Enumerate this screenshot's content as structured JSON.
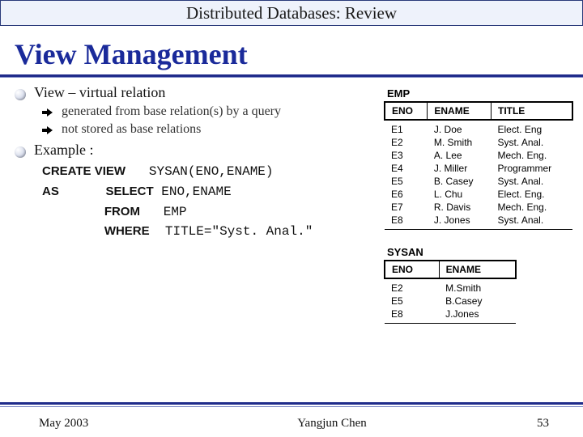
{
  "title_bar": "Distributed Databases: Review",
  "heading": "View Management",
  "bullet_main": "View – virtual relation",
  "sub1": "generated from base relation(s) by a query",
  "sub2": "not stored as base relations",
  "example_label": "Example :",
  "sql": {
    "kw_create": "CREATE VIEW",
    "create_arg": "SYSAN(ENO,ENAME)",
    "kw_as": "AS",
    "kw_select": "SELECT",
    "select_arg": "ENO,ENAME",
    "kw_from": "FROM",
    "from_arg": "EMP",
    "kw_where": "WHERE",
    "where_arg": "TITLE=\"Syst. Anal.\""
  },
  "emp": {
    "caption": "EMP",
    "cols": [
      "ENO",
      "ENAME",
      "TITLE"
    ],
    "rows": [
      [
        "E1",
        "J. Doe",
        "Elect. Eng"
      ],
      [
        "E2",
        "M. Smith",
        "Syst. Anal."
      ],
      [
        "E3",
        "A. Lee",
        "Mech. Eng."
      ],
      [
        "E4",
        "J. Miller",
        "Programmer"
      ],
      [
        "E5",
        "B. Casey",
        "Syst. Anal."
      ],
      [
        "E6",
        "L. Chu",
        "Elect. Eng."
      ],
      [
        "E7",
        "R. Davis",
        "Mech. Eng."
      ],
      [
        "E8",
        "J. Jones",
        "Syst. Anal."
      ]
    ]
  },
  "sysan": {
    "caption": "SYSAN",
    "cols": [
      "ENO",
      "ENAME"
    ],
    "rows": [
      [
        "E2",
        "M.Smith"
      ],
      [
        "E5",
        "B.Casey"
      ],
      [
        "E8",
        "J.Jones"
      ]
    ]
  },
  "footer": {
    "date": "May 2003",
    "author": "Yangjun Chen",
    "page": "53"
  }
}
